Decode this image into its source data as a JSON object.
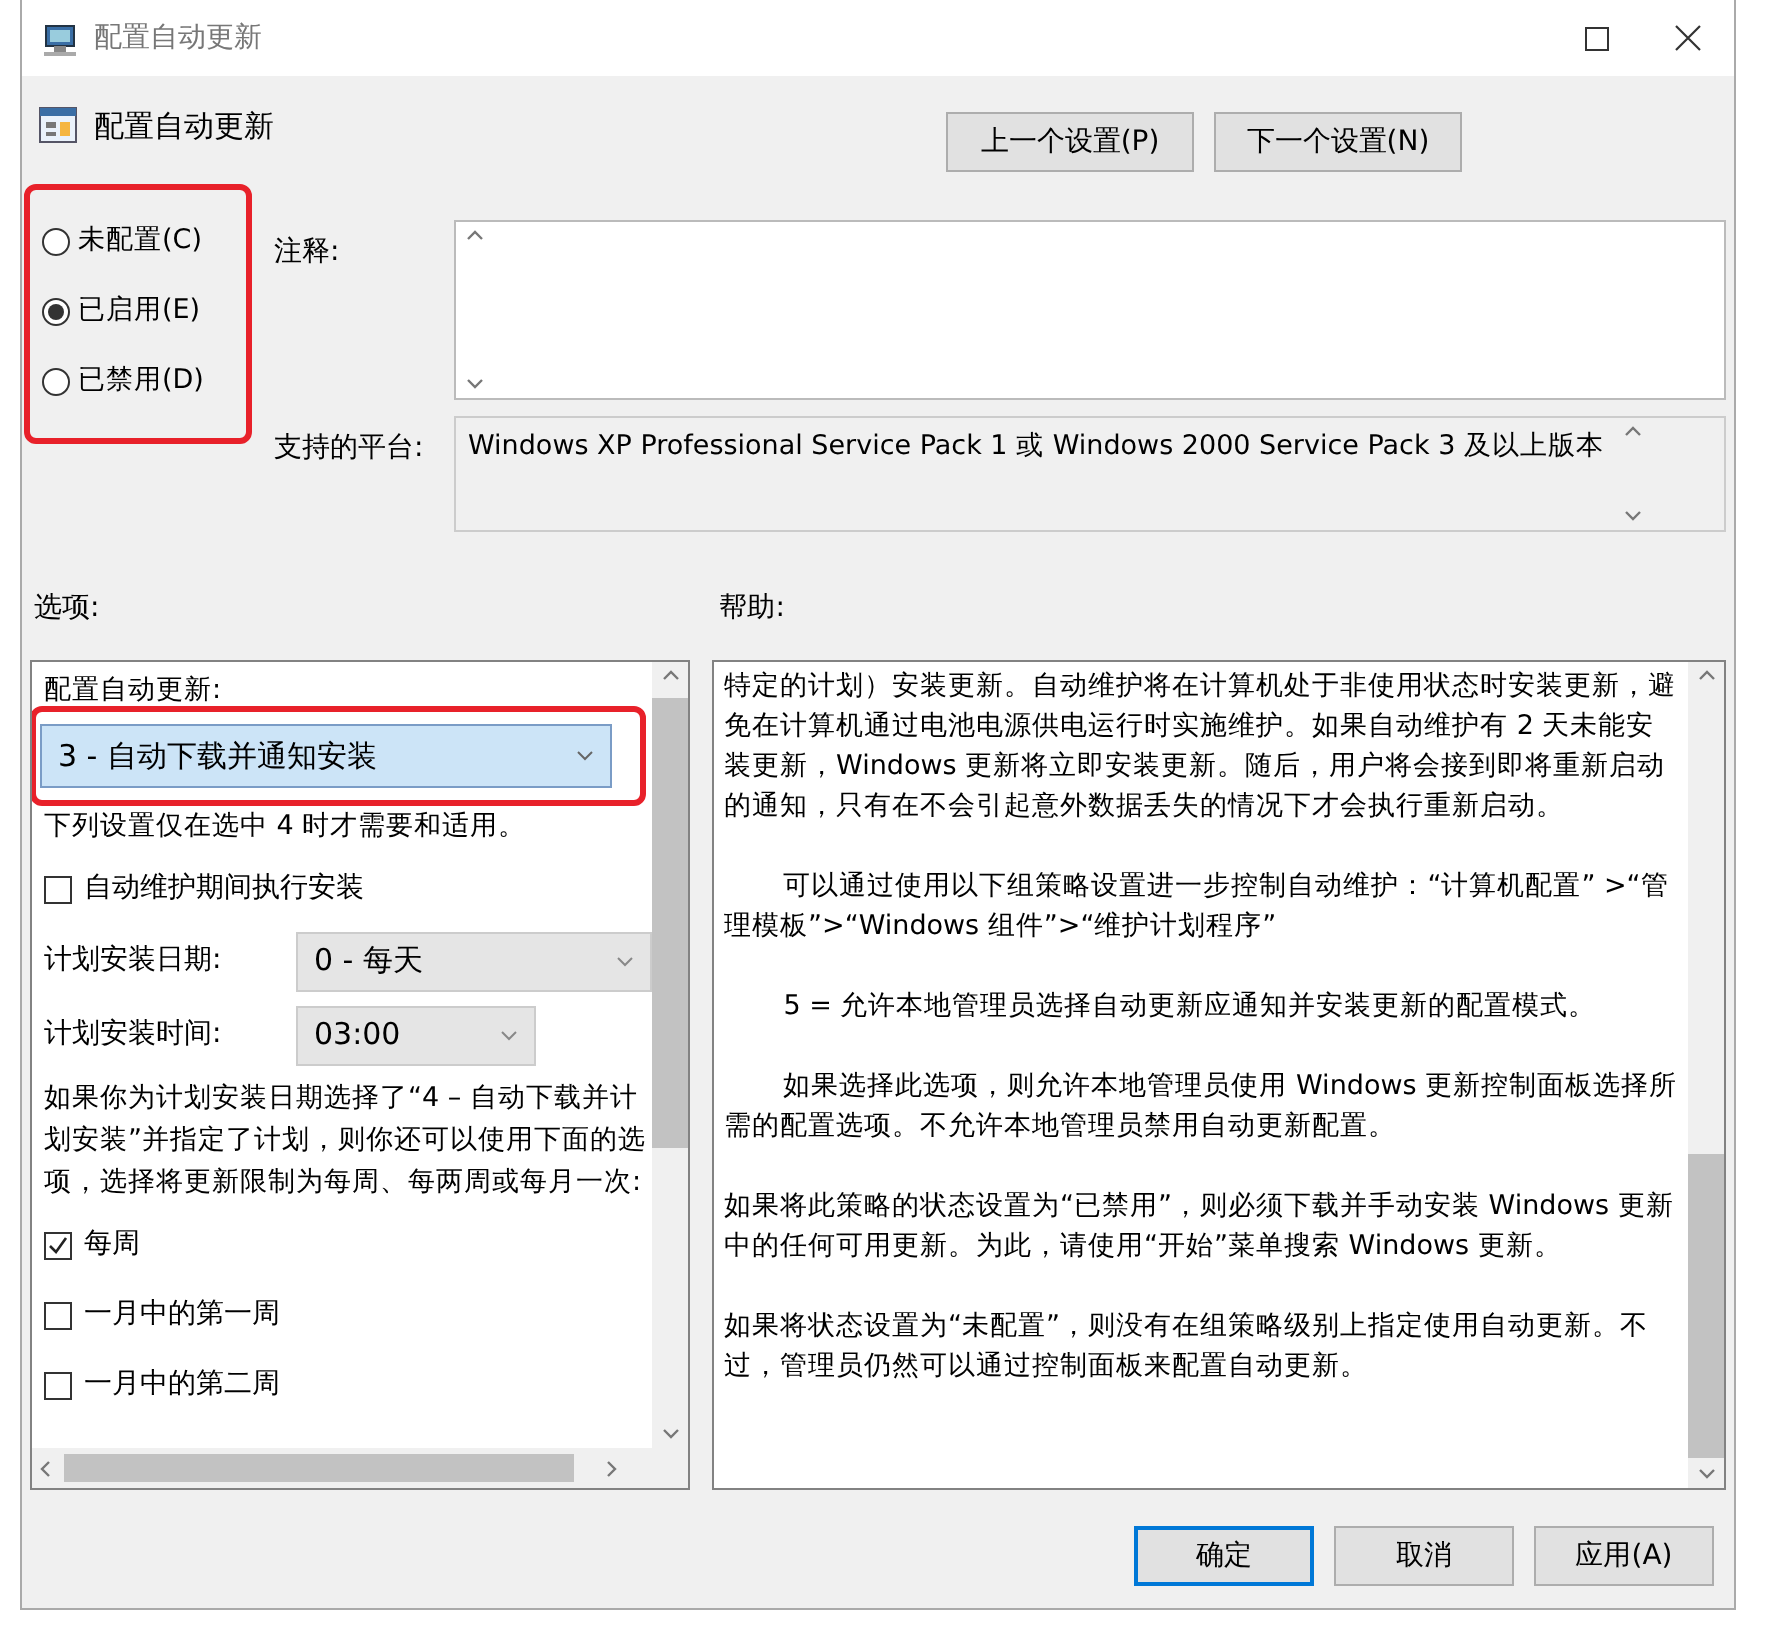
{
  "window": {
    "title": "配置自动更新"
  },
  "header": {
    "title": "配置自动更新",
    "buttons": [
      "上一个设置(P)",
      "下一个设置(N)"
    ]
  },
  "state_radios": {
    "highlighted": true,
    "items": [
      {
        "label": "未配置(C)",
        "selected": false
      },
      {
        "label": "已启用(E)",
        "selected": true
      },
      {
        "label": "已禁用(D)",
        "selected": false
      }
    ]
  },
  "comment": {
    "label": "注释:"
  },
  "platform": {
    "label": "支持的平台:",
    "value": "Windows XP Professional Service Pack 1 或 Windows 2000 Service Pack 3 及以上版本"
  },
  "options_label": "选项:",
  "help_label": "帮助:",
  "options": [
    {
      "kind": "label",
      "text": "配置自动更新:"
    },
    {
      "kind": "dropdown",
      "value": "3 - 自动下载并通知安装",
      "highlighted": true
    },
    {
      "kind": "text",
      "text": "下列设置仅在选中 4 时才需要和适用。"
    },
    {
      "kind": "checkbox",
      "label": "自动维护期间执行安装",
      "checked": false
    },
    {
      "kind": "field",
      "label": "计划安装日期:",
      "value": "0 - 每天"
    },
    {
      "kind": "field",
      "label": "计划安装时间:",
      "value": "03:00"
    },
    {
      "kind": "text",
      "text": "如果你为计划安装日期选择了“4 – 自动下载并计划安装”并指定了计划，则你还可以使用下面的选项，选择将更新限制为每周、每两周或每月一次:"
    },
    {
      "kind": "checkbox",
      "label": "每周",
      "checked": true
    },
    {
      "kind": "checkbox",
      "label": "一月中的第一周",
      "checked": false
    },
    {
      "kind": "checkbox",
      "label": "一月中的第二周",
      "checked": false
    }
  ],
  "help": [
    {
      "text": "特定的计划）安装更新。自动维护将在计算机处于非使用状态时安装更新，避免在计算机通过电池电源供电运行时实施维护。如果自动维护有 2 天未能安装更新，Windows 更新将立即安装更新。随后，用户将会接到即将重新启动的通知，只有在不会引起意外数据丢失的情况下才会执行重新启动。",
      "indent": false
    },
    {
      "text": "可以通过使用以下组策略设置进一步控制自动维护：“计算机配置” >“管理模板”>“Windows 组件”>“维护计划程序”",
      "indent": true
    },
    {
      "text": "5 = 允许本地管理员选择自动更新应通知并安装更新的配置模式。",
      "indent": true
    },
    {
      "text": "如果选择此选项，则允许本地管理员使用 Windows 更新控制面板选择所需的配置选项。不允许本地管理员禁用自动更新配置。",
      "indent": true
    },
    {
      "text": "如果将此策略的状态设置为“已禁用”，则必须下载并手动安装 Windows 更新中的任何可用更新。为此，请使用“开始”菜单搜索 Windows 更新。",
      "indent": false
    },
    {
      "text": "如果将状态设置为“未配置”，则没有在组策略级别上指定使用自动更新。不过，管理员仍然可以通过控制面板来配置自动更新。",
      "indent": false
    }
  ],
  "footer_buttons": [
    {
      "label": "确定",
      "default": true
    },
    {
      "label": "取消",
      "default": false
    },
    {
      "label": "应用(A)",
      "default": false
    }
  ]
}
